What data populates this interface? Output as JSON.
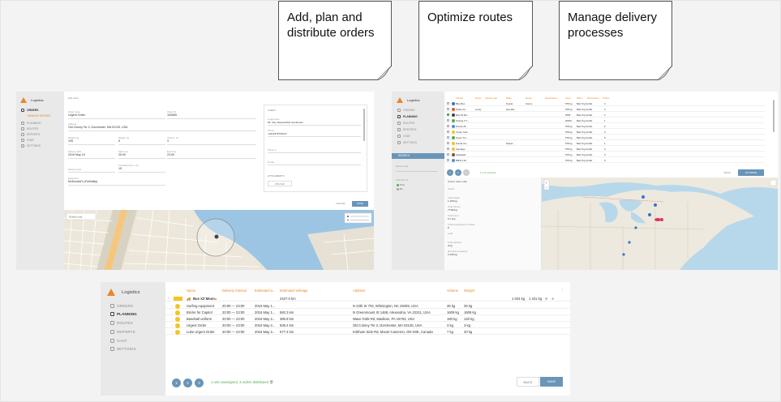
{
  "notes": [
    {
      "text": "Add, plan and distribute orders"
    },
    {
      "text": "Optimize routes"
    },
    {
      "text": "Manage delivery processes"
    }
  ],
  "app1": {
    "logo": "Logistics",
    "nav": [
      "ORDERS",
      "PLANNING",
      "ROUTES",
      "REPORTS",
      "CHAT",
      "SETTINGS"
    ],
    "sub_item": "MANAGE ORDERS",
    "form_title": "Edit order",
    "fields": [
      {
        "label": "Order name",
        "value": "Urgent Order"
      },
      {
        "label": "Order ID",
        "value": "163565"
      },
      {
        "label": "Address",
        "value": "Old Colony Tsr 3, Dorchester, MA 02125, USA"
      },
      {
        "label": "Weight, kg",
        "value": "105"
      },
      {
        "label": "Weight, kg",
        "value": "5"
      },
      {
        "label": "Volume, m³",
        "value": "3"
      },
      {
        "label": "Delivery date",
        "value": "2016 May 19"
      },
      {
        "label": "Start time",
        "value": "20:00"
      },
      {
        "label": "End time",
        "value": "23:00"
      },
      {
        "label": "Delivery type",
        "value": ""
      },
      {
        "label": "Unloading time, min",
        "value": "15"
      },
      {
        "label": "Requester",
        "value": "McDonald's (Full/daily)"
      }
    ],
    "client_title": "CLIENT",
    "client_fields": [
      {
        "label": "Legal name",
        "value": "Mr. Very Responsible Gentleman"
      },
      {
        "label": "Phone",
        "value": "+4912375701913"
      },
      {
        "label": "Phone 2",
        "value": ""
      },
      {
        "label": "E-mail",
        "value": ""
      }
    ],
    "attachments": "ATTACHMENTS",
    "upload": "UPLOAD",
    "cancel": "CANCEL",
    "save": "SAVE"
  },
  "app2": {
    "logo": "Logistics",
    "nav": [
      "ORDERS",
      "PLANNING",
      "ROUTES",
      "REPORTS",
      "CHAT",
      "SETTINGS"
    ],
    "search": "SEARCH",
    "headers": [
      "Vehicle",
      "Driver",
      "Vehicle type",
      "Make",
      "Model",
      "Registration",
      "Carry",
      "Office",
      "Dimensions",
      "Orders"
    ],
    "rows": [
      {
        "name": "Blue Bus",
        "driver": "",
        "make": "Toyota",
        "model": "Camry",
        "carry": "578 kg",
        "office": "Bad Org GmbH",
        "orders": "4",
        "color": "#3b6fd1"
      },
      {
        "name": "Drake Go...",
        "driver": "Lucky",
        "make": "Hyundai",
        "model": "",
        "carry": "578 kg",
        "office": "Bad Org GmbH",
        "orders": "3",
        "color": "#e05a2a"
      },
      {
        "name": "Bus XZ Mo...",
        "driver": "",
        "make": "",
        "model": "",
        "carry": "2535...",
        "office": "Bad Org GmbH",
        "orders": "2",
        "color": "#444444"
      },
      {
        "name": "Orange 9 T...",
        "driver": "",
        "make": "",
        "model": "",
        "carry": "20000...",
        "office": "Bad Org GmbH",
        "orders": "1",
        "color": "#4caf50"
      },
      {
        "name": "Domino B...",
        "driver": "",
        "make": "",
        "model": "",
        "carry": "578 kg",
        "office": "Bad Org GmbH",
        "orders": "0",
        "color": "#4a90d9"
      },
      {
        "name": "Crown Cars",
        "driver": "",
        "make": "",
        "model": "",
        "carry": "578 kg",
        "office": "Bad Org GmbH",
        "orders": "0",
        "color": "#f2c521"
      },
      {
        "name": "Green Tru...",
        "driver": "",
        "make": "",
        "model": "",
        "carry": "578 kg",
        "office": "Bad Org GmbH",
        "orders": "0",
        "color": "#4caf50"
      },
      {
        "name": "Honda Civ...",
        "driver": "",
        "make": "Nissan",
        "model": "",
        "carry": "578 kg",
        "office": "Bad Org GmbH",
        "orders": "1",
        "color": "#f2c521"
      },
      {
        "name": "Sportage...",
        "driver": "",
        "make": "",
        "model": "",
        "carry": "578 kg",
        "office": "Bad Org GmbH",
        "orders": "0",
        "color": "#f2c521"
      },
      {
        "name": "Kawasaki...",
        "driver": "",
        "make": "",
        "model": "",
        "carry": "578 kg",
        "office": "Bad Org GmbH",
        "orders": "0",
        "color": "#7a5a2a"
      },
      {
        "name": "BMW 3 El...",
        "driver": "",
        "make": "",
        "model": "",
        "carry": "578 kg",
        "office": "Bad Org GmbH",
        "orders": "0",
        "color": "#4a90d9"
      }
    ],
    "pages": [
      "1",
      "2",
      "3"
    ],
    "assigned": "1 unit selected",
    "back": "BACK",
    "optimize": "OPTIMIZE",
    "left_label1": "Route mode",
    "left_label2": "Optimize for",
    "options": [
      "Time",
      "Km"
    ],
    "detail_title": "Orders stats order",
    "detail_items": [
      {
        "label": "Orders",
        "value": ""
      },
      {
        "label": "Total weight",
        "value": "1 100 kg"
      },
      {
        "label": "Total volume",
        "value": "77.89 kg"
      },
      {
        "label": "Total count",
        "value": "6.7 pcs"
      },
      {
        "label": "Total unassigned to vehicle",
        "value": "8"
      },
      {
        "label": "Load",
        "value": ""
      },
      {
        "label": "Total capacity",
        "value": "0 kg"
      },
      {
        "label": "Remaining capacity",
        "value": "0 100 kg"
      }
    ]
  },
  "app3": {
    "logo": "Logistics",
    "nav": [
      "ORDERS",
      "PLANNING",
      "ROUTES",
      "REPORTS",
      "CHAT",
      "SETTINGS"
    ],
    "headers": [
      "Name",
      "Delivery interval",
      "Estimated a...",
      "Estimated mileage",
      "Address",
      "Volume",
      "Weight"
    ],
    "group_row": {
      "name": "Bus XZ Moon",
      "mileage": "2427.0 km",
      "volume": "1 024 kg",
      "weight": "1 341 kg"
    },
    "rows": [
      {
        "name": "Surfing equipment",
        "interval": "20:00 — 23:00",
        "eta": "2016 May 1...",
        "mileage": "",
        "address": "N 23th St 703, Wilmington, NC 28405, USA",
        "volume": "35 kg",
        "weight": "35 kg"
      },
      {
        "name": "Bricks for Capitol",
        "interval": "20:00 — 23:00",
        "eta": "2016 May 1...",
        "mileage": "582.3 km",
        "address": "N Greenmount St 1468, Alexandria, VA 22311, USA",
        "volume": "1609 kg",
        "weight": "1609 kg"
      },
      {
        "name": "Baseball uniform",
        "interval": "20:00 — 23:00",
        "eta": "2016 May 2...",
        "mileage": "380.8 km",
        "address": "Wave Falls Rd, Madison, PA 15763, USA",
        "volume": "180 kg",
        "weight": "120 kg"
      },
      {
        "name": "Urgent Order",
        "interval": "20:00 — 23:00",
        "eta": "2016 May 2...",
        "mileage": "836.4 km",
        "address": "Old Colony Tsr 3, Dorchester, MA 02125, USA",
        "volume": "3 kg",
        "weight": "3 kg"
      },
      {
        "name": "Luke Urgent Order",
        "interval": "20:00 — 23:00",
        "eta": "2016 May 2...",
        "mileage": "577.4 km",
        "address": "Kirkham Side Rd, Mount Cameron, ON N0K, Canada",
        "volume": "7 kg",
        "weight": "20 kg"
      }
    ],
    "pages": [
      "1",
      "2",
      "3"
    ],
    "status": "1 unit unassigned, 3 orders distributed",
    "back": "BACK",
    "save": "SAVE"
  },
  "colors": {
    "accent": "#e8872a",
    "primary": "#6a95b8",
    "yellow": "#f2c521"
  }
}
